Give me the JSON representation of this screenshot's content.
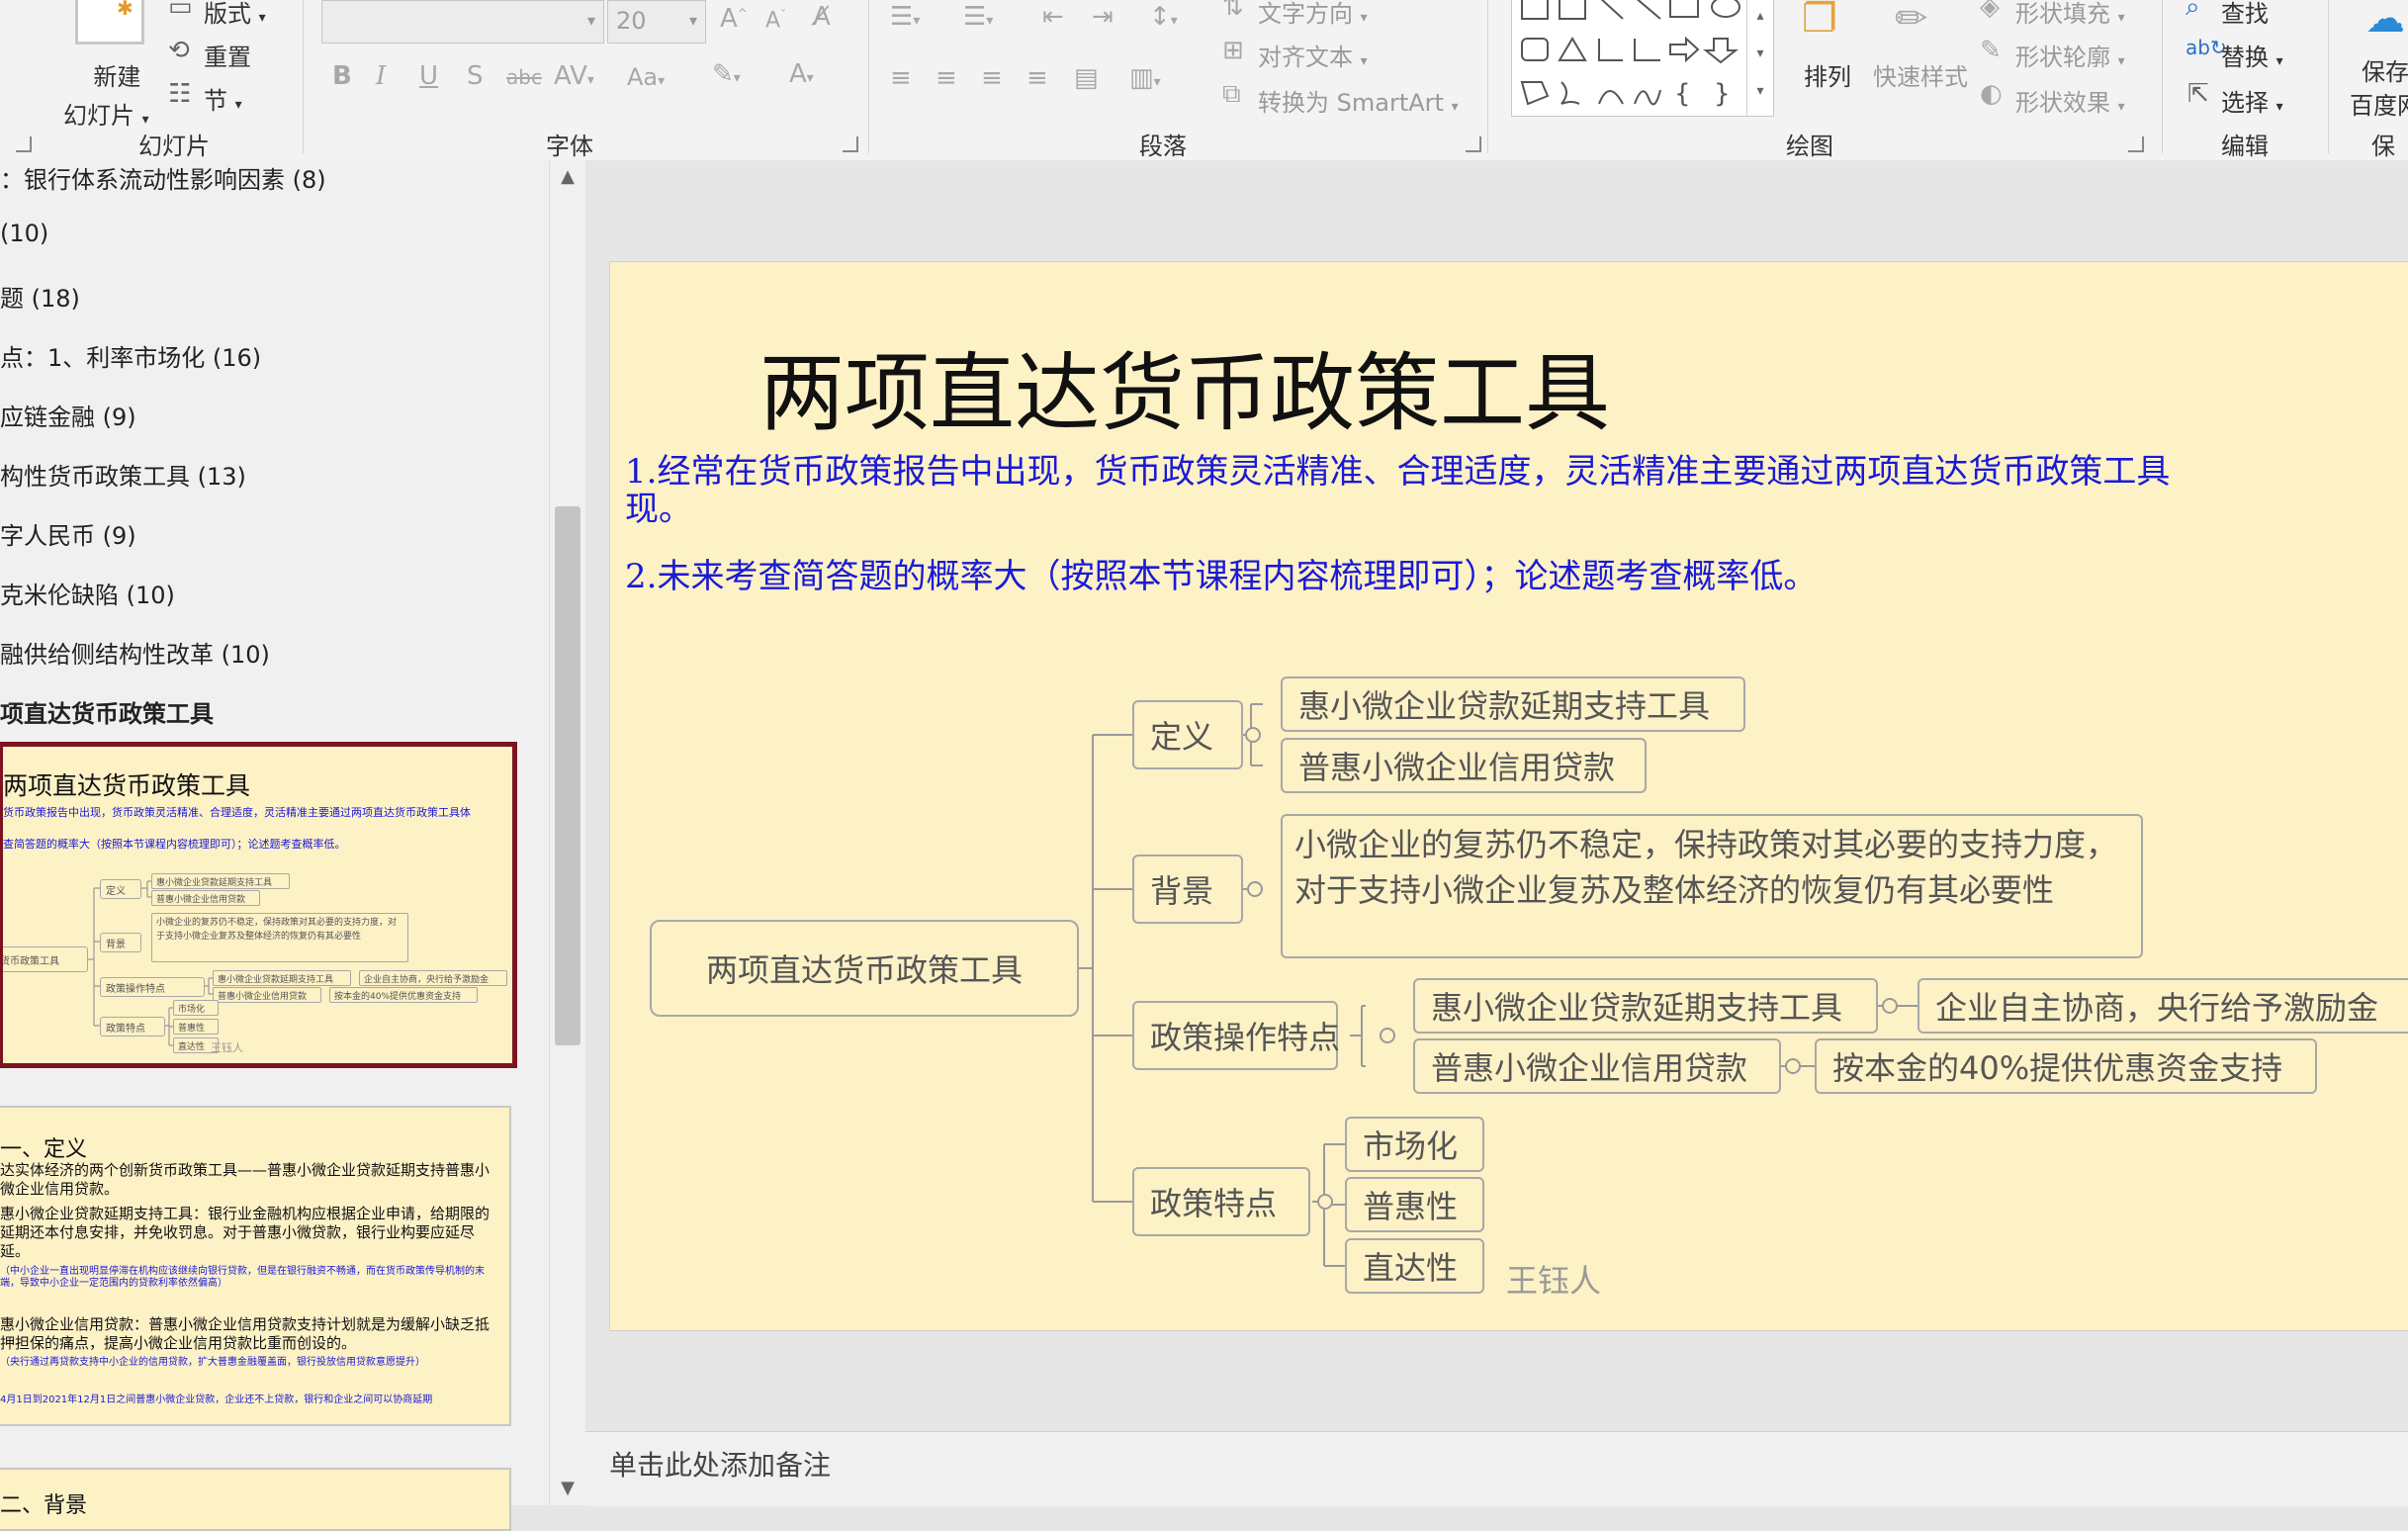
{
  "ribbon": {
    "slides_group": {
      "new_slide": "新建",
      "new_slide2": "幻灯片",
      "layout": "版式",
      "reset": "重置",
      "section": "节",
      "label": "幻灯片"
    },
    "font_group": {
      "font_size": "20",
      "label": "字体"
    },
    "paragraph_group": {
      "text_direction": "文字方向",
      "align_text": "对齐文本",
      "convert_smartart": "转换为 SmartArt",
      "label": "段落"
    },
    "drawing_group": {
      "arrange": "排列",
      "quick_styles": "快速样式",
      "shape_fill": "形状填充",
      "shape_outline": "形状轮廓",
      "shape_effects": "形状效果",
      "label": "绘图"
    },
    "editing_group": {
      "find": "查找",
      "replace": "替换",
      "select": "选择",
      "label": "编辑"
    },
    "save_group": {
      "save": "保存",
      "baidu": "百度网",
      "label": "保存"
    }
  },
  "outline": {
    "items": [
      "：银行体系流动性影响因素 (8)",
      "(10)",
      "题 (18)",
      "点：1、利率市场化 (16)",
      "应链金融 (9)",
      "构性货币政策工具 (13)",
      "字人民币 (9)",
      "克米伦缺陷 (10)",
      "融供给侧结构性改革 (10)",
      "项直达货币政策工具"
    ],
    "thumb1": {
      "title": "两项直达货币政策工具",
      "line1": "货币政策报告中出现，货币政策灵活精准、合理适度，灵活精准主要通过两项直达货币政策工具体",
      "line2": "查简答题的概率大（按照本节课程内容梳理即可）；论述题考查概率低。",
      "root": "达货币政策工具",
      "n1": "定义",
      "n2": "背景",
      "n3": "政策操作特点",
      "n4": "政策特点",
      "l1": "惠小微企业贷款延期支持工具",
      "l2": "普惠小微企业信用贷款",
      "l3": "小微企业的复苏仍不稳定，保持政策对其必要的支持力度，对于支持小微企业复苏及整体经济的恢复仍有其必要性",
      "l4": "惠小微企业贷款延期支持工具",
      "l5": "普惠小微企业信用贷款",
      "l6": "企业自主协商，央行给予激励金",
      "l7": "按本金的40%提供优惠资金支持",
      "l8": "市场化",
      "l9": "普惠性",
      "l10": "直达性",
      "author": "王钰人"
    },
    "thumb2": {
      "heading": "一、定义",
      "p1": "达实体经济的两个创新货币政策工具——普惠小微企业贷款延期支持普惠小微企业信用贷款。",
      "p2": "惠小微企业贷款延期支持工具：银行业金融机构应根据企业申请，给期限的延期还本付息安排，并免收罚息。对于普惠小微贷款，银行业构要应延尽延。",
      "p3": "（中小企业一直出现明显停滞在机构应该继续向银行贷款，但是在银行融资不畅通，而在货币政策传导机制的末端，导致中小企业一定范围内的贷款利率依然偏高）",
      "p4": "惠小微企业信用贷款：普惠小微企业信用贷款支持计划就是为缓解小缺乏抵押担保的痛点，提高小微企业信用贷款比重而创设的。",
      "p5": "（央行通过再贷款支持中小企业的信用贷款，扩大普惠金融覆盖面，银行投放信用贷款意愿提升）",
      "p6": "4月1日到2021年12月1日之间普惠小微企业贷款，企业还不上贷款，银行和企业之间可以协商延期",
      "heading2": "二、背景"
    }
  },
  "slide": {
    "title": "两项直达货币政策工具",
    "line1": "1.经常在货币政策报告中出现，货币政策灵活精准、合理适度，灵活精准主要通过两项直达货币政策工具",
    "line1b": "现。",
    "line2": "2.未来考查简答题的概率大（按照本节课程内容梳理即可）；论述题考查概率低。",
    "mindmap": {
      "root": "两项直达货币政策工具",
      "branches": {
        "definition": {
          "label": "定义",
          "leaves": [
            "惠小微企业贷款延期支持工具",
            "普惠小微企业信用贷款"
          ]
        },
        "background": {
          "label": "背景",
          "text": "小微企业的复苏仍不稳定，保持政策对其必要的支持力度，对于支持小微企业复苏及整体经济的恢复仍有其必要性"
        },
        "operation": {
          "label": "政策操作特点",
          "leaves": [
            "惠小微企业贷款延期支持工具",
            "普惠小微企业信用贷款"
          ],
          "sub": [
            "企业自主协商，央行给予激励金",
            "按本金的40%提供优惠资金支持"
          ]
        },
        "features": {
          "label": "政策特点",
          "leaves": [
            "市场化",
            "普惠性",
            "直达性"
          ]
        }
      }
    },
    "author": "王钰人"
  },
  "notes": {
    "placeholder": "单击此处添加备注"
  }
}
